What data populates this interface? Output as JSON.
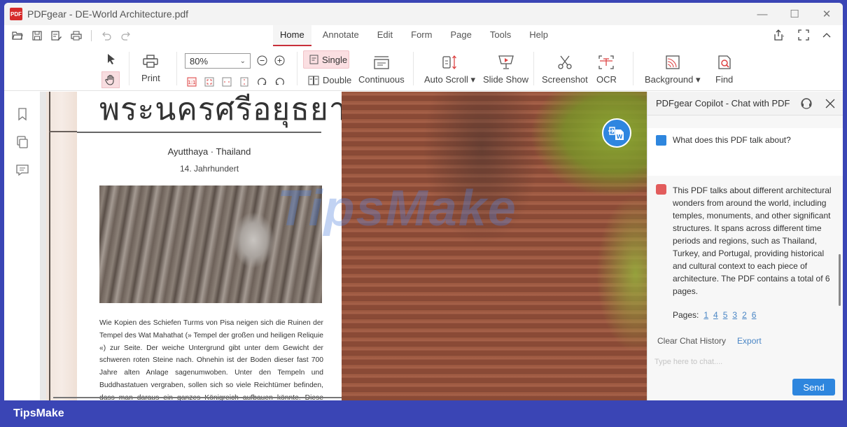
{
  "window": {
    "app_title": "PDFgear - DE-World Architecture.pdf",
    "logo_text": "PDF",
    "controls": {
      "minimize": "—",
      "maximize": "☐",
      "close": "✕"
    }
  },
  "quick_toolbar": {
    "icons": [
      "open-folder-icon",
      "save-icon",
      "save-as-icon",
      "print-icon",
      "undo-icon",
      "redo-icon"
    ]
  },
  "tabs": [
    {
      "label": "Home",
      "active": true
    },
    {
      "label": "Annotate",
      "active": false
    },
    {
      "label": "Edit",
      "active": false
    },
    {
      "label": "Form",
      "active": false
    },
    {
      "label": "Page",
      "active": false
    },
    {
      "label": "Tools",
      "active": false
    },
    {
      "label": "Help",
      "active": false
    }
  ],
  "ribbon": {
    "print_label": "Print",
    "zoom_value": "80%",
    "zoom_caret": "⌄",
    "single_label": "Single",
    "double_label": "Double",
    "continuous_label": "Continuous",
    "auto_scroll_label": "Auto Scroll ▾",
    "slide_show_label": "Slide Show",
    "screenshot_label": "Screenshot",
    "ocr_label": "OCR",
    "background_label": "Background ▾",
    "find_label": "Find"
  },
  "document": {
    "thai_title": "พระนครศรีอยุธยา",
    "location": "Ayutthaya · Thailand",
    "century": "14. Jahrhundert",
    "body": "Wie Kopien des Schiefen Turms von Pisa neigen sich die Ruinen der Tempel des Wat Mahathat (» Tempel der großen und heiligen Reliquie «) zur Seite. Der weiche Untergrund gibt unter dem Gewicht der schweren roten Steine nach. Ohnehin ist der Boden dieser fast 700 Jahre alten Anlage sagenumwoben. Unter den Tempeln und Buddhastatuen vergraben, sollen sich so viele Reichtümer befinden, dass man daraus ein ganzes Königreich aufbauen könnte. Diese Erzählungen nährte ein",
    "watermark": "TipsMake"
  },
  "chat": {
    "title": "PDFgear Copilot - Chat with PDF",
    "user_message": "What does this PDF talk about?",
    "bot_message": "This PDF talks about different architectural wonders from around the world, including temples, monuments, and other significant structures. It spans across different time periods and regions, such as Thailand, Turkey, and Portugal, providing historical and cultural context to each piece of architecture. The PDF contains a total of 6 pages.",
    "pages_label": "Pages:",
    "page_refs": [
      "1",
      "4",
      "5",
      "3",
      "2",
      "6"
    ],
    "clear_label": "Clear Chat History",
    "export_label": "Export",
    "input_placeholder": "Type here to chat....",
    "input_value": "",
    "send_label": "Send"
  },
  "brand": {
    "label": "TipsMake"
  },
  "colors": {
    "accent_red": "#c8303a",
    "accent_blue": "#2e86de",
    "frame_blue": "#3a45b5"
  }
}
